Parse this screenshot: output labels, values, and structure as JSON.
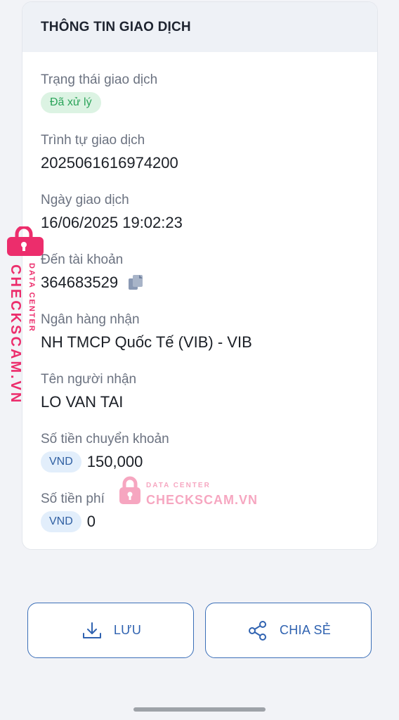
{
  "card": {
    "title": "THÔNG TIN GIAO DỊCH"
  },
  "fields": {
    "status_label": "Trạng thái giao dịch",
    "status_value": "Đã xử lý",
    "sequence_label": "Trình tự giao dịch",
    "sequence_value": "2025061616974200",
    "date_label": "Ngày giao dịch",
    "date_value": "16/06/2025 19:02:23",
    "account_label": "Đến tài khoản",
    "account_value": "364683529",
    "bank_label": "Ngân hàng nhận",
    "bank_value": "NH TMCP Quốc Tế (VIB) - VIB",
    "recipient_label": "Tên người nhận",
    "recipient_value": "LO VAN TAI",
    "amount_label": "Số tiền chuyển khoản",
    "amount_currency": "VND",
    "amount_value": "150,000",
    "fee_label": "Số tiền phí",
    "fee_currency": "VND",
    "fee_value": "0"
  },
  "actions": {
    "save_label": "LƯU",
    "share_label": "CHIA SẺ"
  },
  "watermark": {
    "brand": "CHECKSCAM.VN",
    "subtitle": "DATA CENTER"
  },
  "colors": {
    "accent": "#2f62b0",
    "status_green": "#2ba45a",
    "watermark_pink": "#ec2d6c"
  }
}
